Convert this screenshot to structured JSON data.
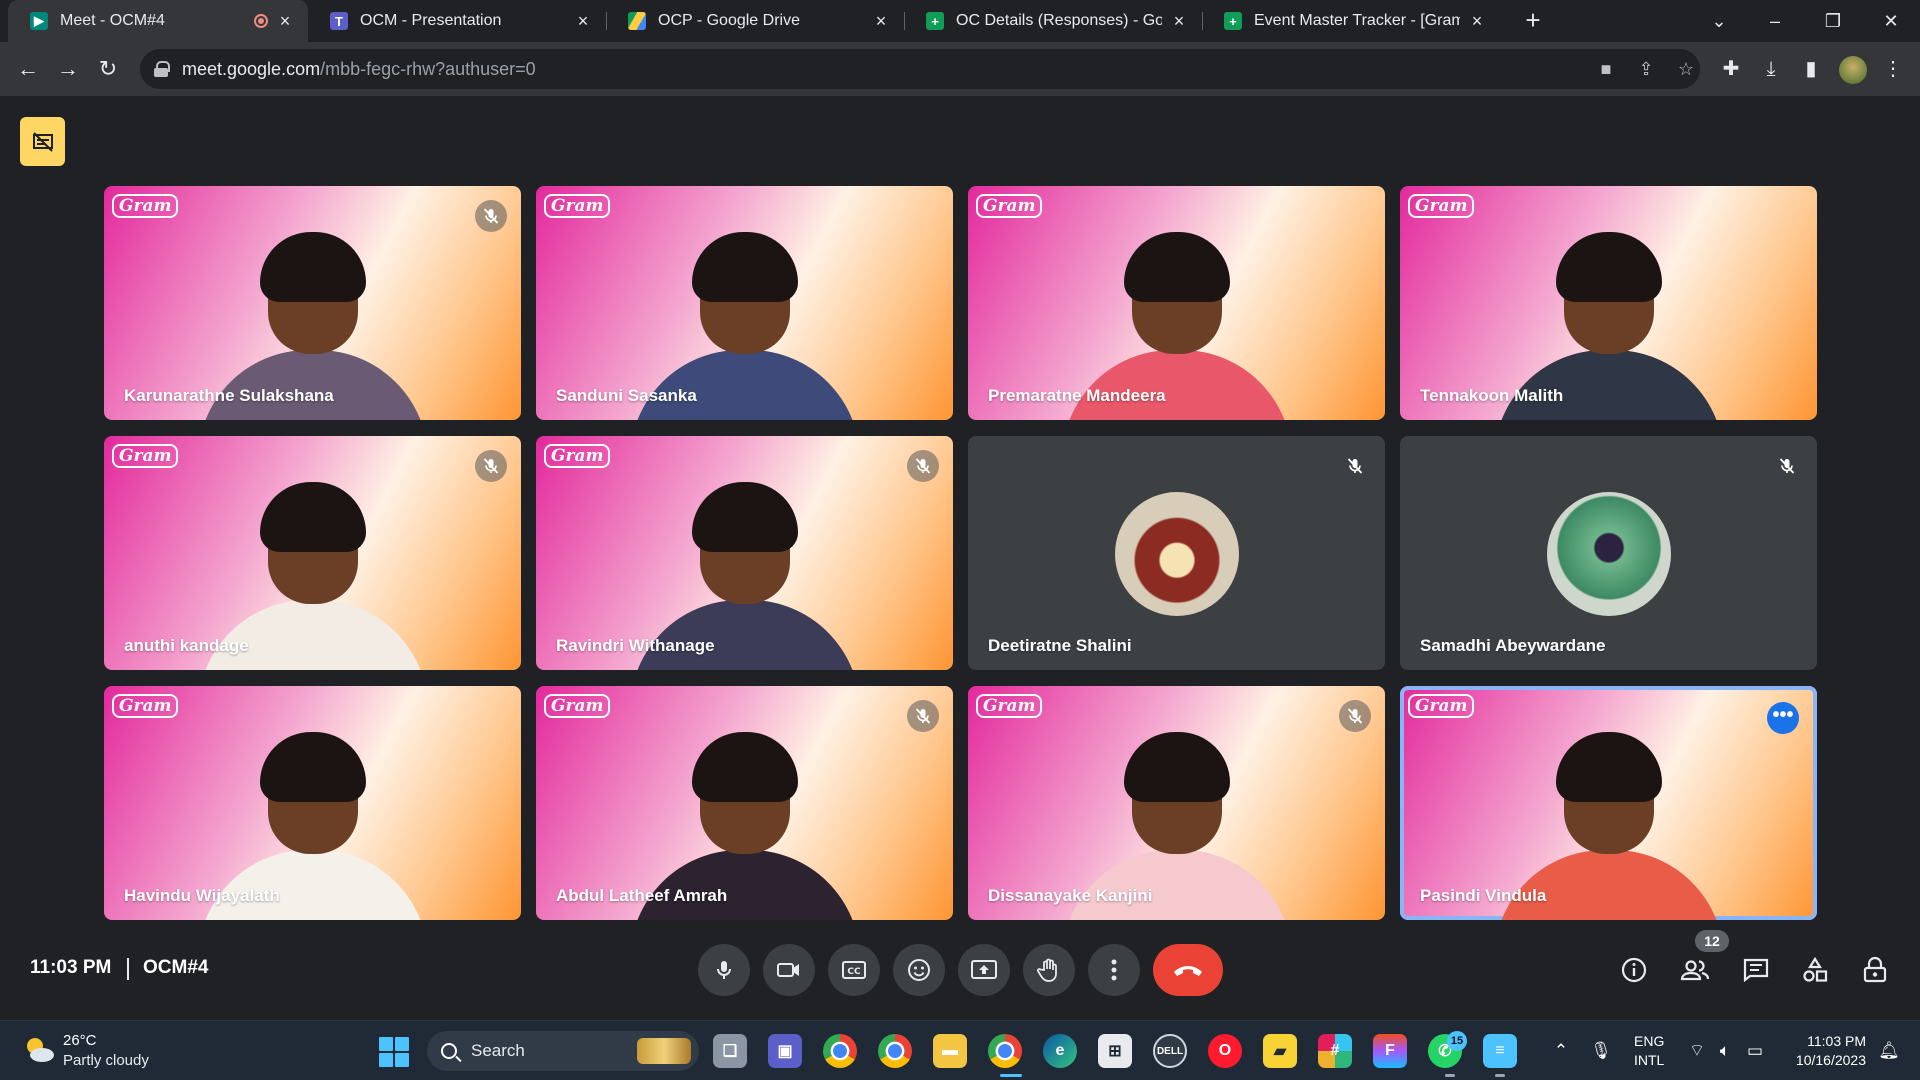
{
  "browser": {
    "tabs": [
      {
        "title": "Meet - OCM#4",
        "recording": true,
        "active": true
      },
      {
        "title": "OCM - Presentation"
      },
      {
        "title": "OCP - Google Drive"
      },
      {
        "title": "OC Details (Responses) - Google"
      },
      {
        "title": "Event Master Tracker - [GramFes"
      }
    ],
    "new_tab_label": "+",
    "url_host": "meet.google.com",
    "url_path": "/mbb-fegc-rhw?authuser=0"
  },
  "meet": {
    "brand_watermark": "Gram",
    "participants": [
      {
        "name": "Karunarathne Sulakshana",
        "muted": true,
        "video": true
      },
      {
        "name": "Sanduni Sasanka",
        "muted": false,
        "video": true
      },
      {
        "name": "Premaratne Mandeera",
        "muted": false,
        "video": true
      },
      {
        "name": "Tennakoon Malith",
        "muted": false,
        "video": true
      },
      {
        "name": "anuthi kandage",
        "muted": true,
        "video": true
      },
      {
        "name": "Ravindri Withanage",
        "muted": true,
        "video": true
      },
      {
        "name": "Deetiratne Shalini",
        "muted": true,
        "video": false
      },
      {
        "name": "Samadhi Abeywardane",
        "muted": true,
        "video": false
      },
      {
        "name": "Havindu Wijayalath",
        "muted": false,
        "video": true
      },
      {
        "name": "Abdul Latheef Amrah",
        "muted": true,
        "video": true
      },
      {
        "name": "Dissanayake Kanjini",
        "muted": true,
        "video": true
      },
      {
        "name": "Pasindi Vindula",
        "muted": false,
        "video": true,
        "speaking": true
      }
    ],
    "clock": "11:03 PM",
    "meeting_code": "OCM#4",
    "participant_count": "12",
    "colors": {
      "end_call": "#ea4335",
      "accent": "#8ab4f8",
      "presenter_badge": "#fdd663"
    }
  },
  "taskbar": {
    "weather_temp": "26°C",
    "weather_desc": "Partly cloudy",
    "search_label": "Search",
    "whatsapp_badge": "15",
    "lang_primary": "ENG",
    "lang_secondary": "INTL",
    "time": "11:03 PM",
    "date": "10/16/2023"
  }
}
